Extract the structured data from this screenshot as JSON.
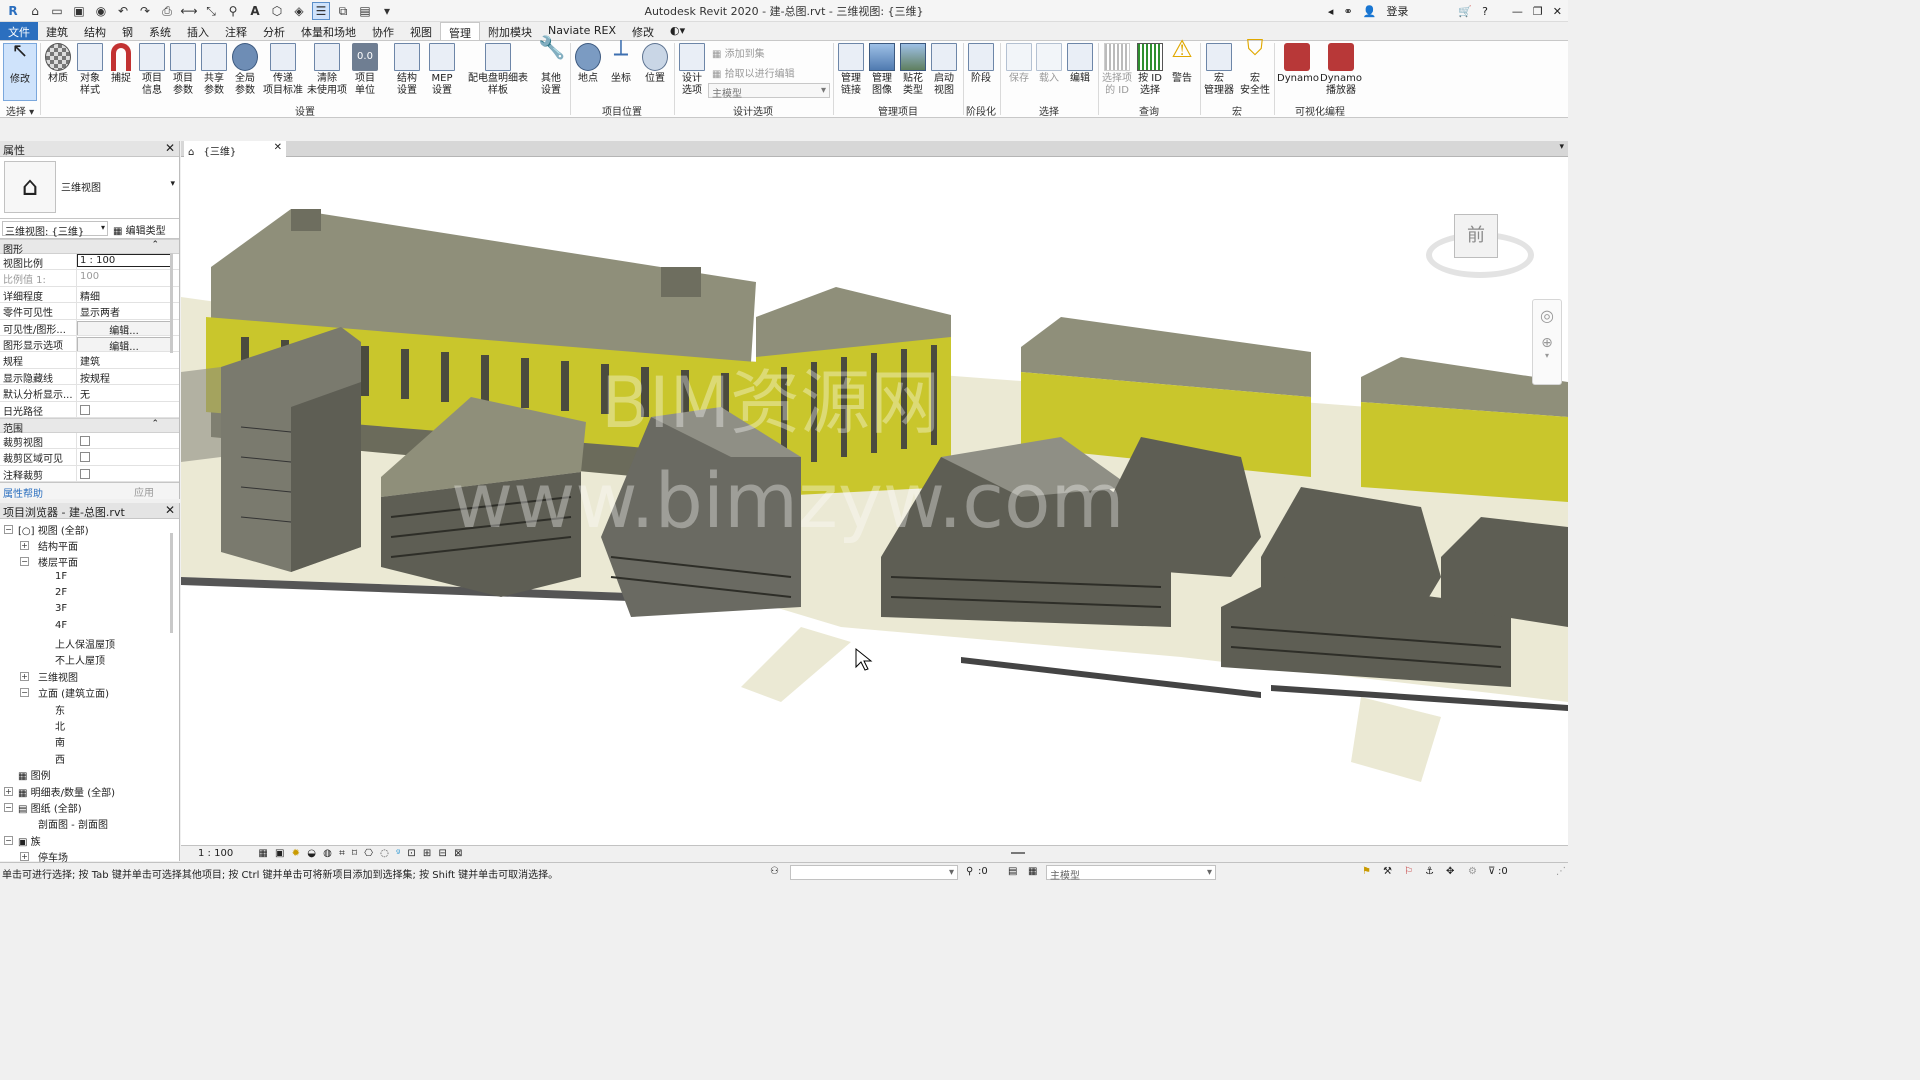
{
  "app": {
    "title": "Autodesk Revit 2020 - 建-总图.rvt - 三维视图: {三维}",
    "login": "登录"
  },
  "ribbon_tabs": [
    {
      "label": "文件"
    },
    {
      "label": "建筑"
    },
    {
      "label": "结构"
    },
    {
      "label": "钢"
    },
    {
      "label": "系统"
    },
    {
      "label": "插入"
    },
    {
      "label": "注释"
    },
    {
      "label": "分析"
    },
    {
      "label": "体量和场地"
    },
    {
      "label": "协作"
    },
    {
      "label": "视图"
    },
    {
      "label": "管理"
    },
    {
      "label": "附加模块"
    },
    {
      "label": "Naviate REX"
    },
    {
      "label": "修改"
    }
  ],
  "ribbon": {
    "buttons": {
      "modify": "修改",
      "material": "材质",
      "object_style_1": "对象",
      "object_style_2": "样式",
      "snap": "捕捉",
      "proj_info_1": "项目",
      "proj_info_2": "信息",
      "proj_param_1": "项目",
      "proj_param_2": "参数",
      "shared_1": "共享",
      "shared_2": "参数",
      "global_1": "全局",
      "global_2": "参数",
      "transfer_1": "传递",
      "transfer_2": "项目标准",
      "purge_1": "清除",
      "purge_2": "未使用项",
      "units_1": "项目",
      "units_2": "单位",
      "struct_1": "结构",
      "struct_2": "设置",
      "mep_1": "MEP",
      "mep_2": "设置",
      "panel_1": "配电盘明细表",
      "panel_2": "样板",
      "other_1": "其他",
      "other_2": "设置",
      "location": "地点",
      "coords": "坐标",
      "position": "位置",
      "design_opt_1": "设计",
      "design_opt_2": "选项",
      "add_to_set": "添加到集",
      "pick_edit": "拾取以进行编辑",
      "main_model": "主模型",
      "manage_links_1": "管理",
      "manage_links_2": "链接",
      "manage_images_1": "管理",
      "manage_images_2": "图像",
      "decal_1": "贴花",
      "decal_2": "类型",
      "startup_1": "启动",
      "startup_2": "视图",
      "phases": "阶段",
      "save": "保存",
      "load": "载入",
      "edit": "编辑",
      "select_by_id_1": "选择项",
      "select_by_id_2": "的 ID",
      "by_id_1": "按 ID",
      "by_id_2": "选择",
      "warnings": "警告",
      "macro_mgr_1": "宏",
      "macro_mgr_2": "管理器",
      "macro_sec_1": "宏",
      "macro_sec_2": "安全性",
      "dynamo": "Dynamo",
      "dynamo_player_1": "Dynamo",
      "dynamo_player_2": "播放器"
    },
    "groups": {
      "select": "选择",
      "settings": "设置",
      "project_location": "项目位置",
      "design_options": "设计选项",
      "manage_project": "管理项目",
      "phasing": "阶段化",
      "selection": "选择",
      "inquiry": "查询",
      "macros": "宏",
      "visual_programming": "可视化编程"
    }
  },
  "properties": {
    "title": "属性",
    "type_name": "三维视图",
    "view_selector": "三维视图: {三维}",
    "edit_type": "编辑类型",
    "section_graphics": "图形",
    "rows": [
      {
        "k": "视图比例",
        "v": "1 : 100"
      },
      {
        "k": "比例值 1:",
        "v": "100"
      },
      {
        "k": "详细程度",
        "v": "精细"
      },
      {
        "k": "零件可见性",
        "v": "显示两者"
      },
      {
        "k": "可见性/图形...",
        "v": "编辑..."
      },
      {
        "k": "图形显示选项",
        "v": "编辑..."
      },
      {
        "k": "规程",
        "v": "建筑"
      },
      {
        "k": "显示隐藏线",
        "v": "按规程"
      },
      {
        "k": "默认分析显示...",
        "v": "无"
      },
      {
        "k": "日光路径",
        "v": ""
      }
    ],
    "section_extents": "范围",
    "extent_rows": [
      {
        "k": "裁剪视图"
      },
      {
        "k": "裁剪区域可见"
      },
      {
        "k": "注释裁剪"
      }
    ],
    "help": "属性帮助",
    "apply": "应用"
  },
  "browser": {
    "title": "项目浏览器 - 建-总图.rvt",
    "items": [
      "视图 (全部)",
      "结构平面",
      "楼层平面",
      "1F",
      "2F",
      "3F",
      "4F",
      "上人保温屋顶",
      "不上人屋顶",
      "三维视图",
      "立面 (建筑立面)",
      "东",
      "北",
      "南",
      "西",
      "图例",
      "明细表/数量 (全部)",
      "图纸 (全部)",
      "剖面图 - 剖面图",
      "族",
      "停车场"
    ]
  },
  "view": {
    "tab_label": "{三维}",
    "watermark_1": "BIM资源网",
    "watermark_2": "www.bimzyw.com",
    "viewcube_face": "前",
    "scale": "1 : 100"
  },
  "status": {
    "hint": "单击可进行选择; 按 Tab 键并单击可选择其他项目; 按 Ctrl 键并单击可将新项目添加到选择集; 按 Shift 键并单击可取消选择。",
    "count_left": ":0",
    "main_model": "主模型",
    "filter_count": ":0"
  },
  "colors": {
    "accent": "#2b6fbf",
    "facade_yellow": "#c9c62c",
    "roof": "#8f8f7a",
    "ground": "#ebe9d4"
  }
}
